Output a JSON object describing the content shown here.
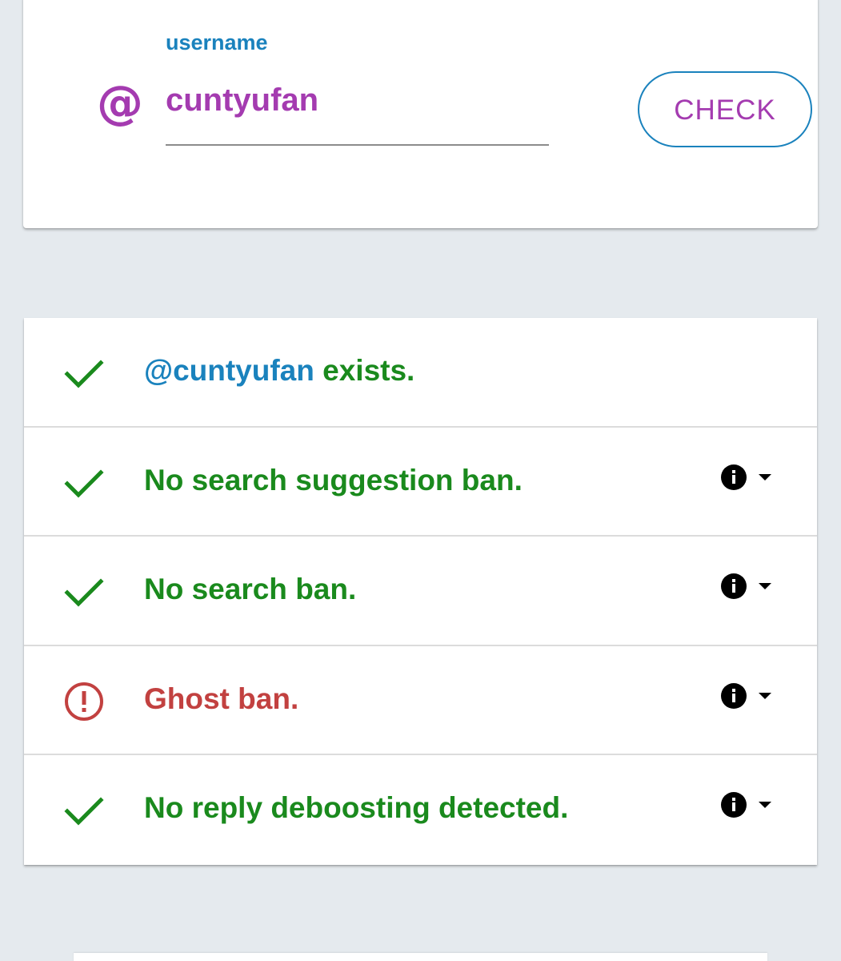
{
  "search": {
    "label": "username",
    "prefix_icon": "at-sign-icon",
    "value": "cuntyufan",
    "button_label": "CHECK"
  },
  "results": [
    {
      "status": "ok",
      "icon": "check-icon",
      "handle": "@cuntyufan",
      "text": " exists.",
      "has_info": false
    },
    {
      "status": "ok",
      "icon": "check-icon",
      "text": "No search suggestion ban.",
      "has_info": true
    },
    {
      "status": "ok",
      "icon": "check-icon",
      "text": "No search ban.",
      "has_info": true
    },
    {
      "status": "bad",
      "icon": "alert-circle-icon",
      "text": "Ghost ban.",
      "has_info": true
    },
    {
      "status": "ok",
      "icon": "check-icon",
      "text": "No reply deboosting detected.",
      "has_info": true
    }
  ],
  "colors": {
    "accent": "#a43bb0",
    "link": "#1a82bd",
    "success": "#1a8a1d",
    "error": "#c24140",
    "background": "#e5eaee"
  }
}
